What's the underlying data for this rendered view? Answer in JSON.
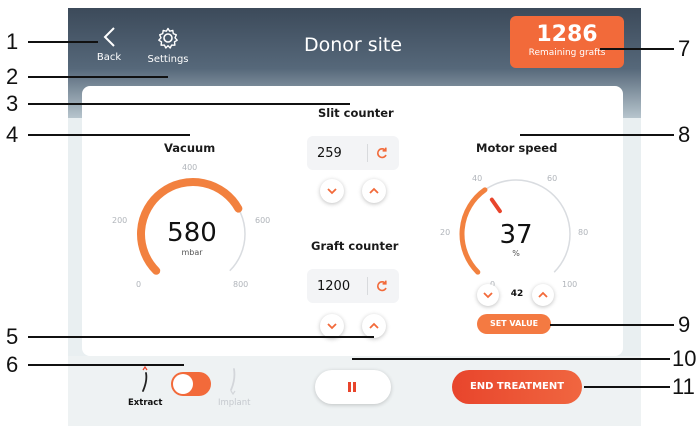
{
  "callouts": [
    "1",
    "2",
    "3",
    "4",
    "5",
    "6",
    "7",
    "8",
    "9",
    "10",
    "11"
  ],
  "header": {
    "back_label": "Back",
    "settings_label": "Settings",
    "title": "Donor site",
    "remaining_value": "1286",
    "remaining_label": "Remaining grafts"
  },
  "vacuum": {
    "label": "Vacuum",
    "value": "580",
    "unit": "mbar",
    "ticks": [
      "0",
      "200",
      "400",
      "600",
      "800"
    ],
    "fraction": 0.725
  },
  "slit_counter": {
    "label": "Slit counter",
    "value": "259"
  },
  "graft_counter": {
    "label": "Graft counter",
    "value": "1200"
  },
  "motor": {
    "label": "Motor speed",
    "value": "37",
    "unit": "%",
    "setpoint": "42",
    "ticks": [
      "0",
      "20",
      "40",
      "60",
      "80",
      "100"
    ],
    "set_value_label": "SET VALUE",
    "fraction": 0.37
  },
  "mode": {
    "extract_label": "Extract",
    "implant_label": "Implant"
  },
  "end_treatment_label": "END TREATMENT",
  "colors": {
    "accent": "#f26a3a",
    "header": "#3c4a5a"
  }
}
